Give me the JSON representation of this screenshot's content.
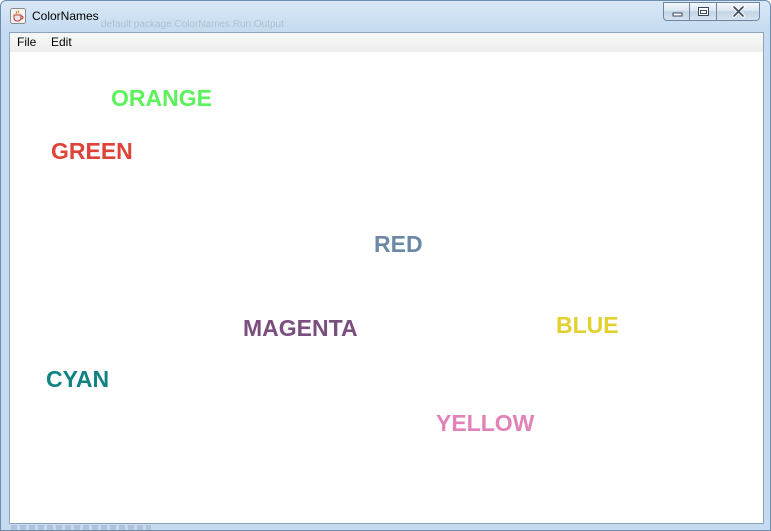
{
  "window": {
    "title": "ColorNames",
    "background_faded_text": "default package  ColorNames  Run  Output"
  },
  "menu": {
    "items": [
      "File",
      "Edit"
    ]
  },
  "words": [
    {
      "text": "ORANGE",
      "color": "#5cf25c"
    },
    {
      "text": "GREEN",
      "color": "#df4238"
    },
    {
      "text": "RED",
      "color": "#6d88a6"
    },
    {
      "text": "MAGENTA",
      "color": "#7a4e7e"
    },
    {
      "text": "BLUE",
      "color": "#e3d131"
    },
    {
      "text": "CYAN",
      "color": "#118282"
    },
    {
      "text": "YELLOW",
      "color": "#e283b7"
    }
  ],
  "icons": {
    "app": "java-coffee-cup-icon",
    "minimize": "minimize-icon",
    "maximize": "restore-icon",
    "close": "close-icon"
  }
}
